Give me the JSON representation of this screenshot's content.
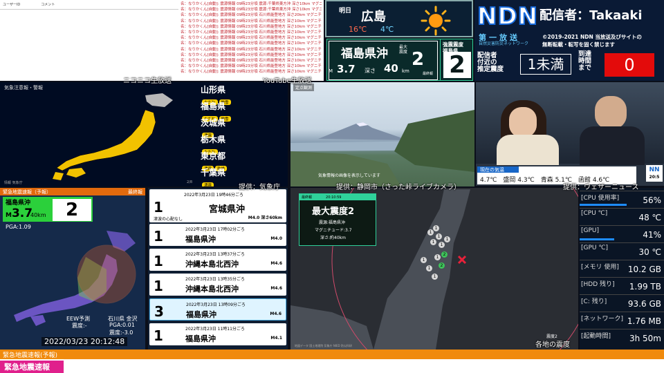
{
  "comments_left": {
    "col1": "ユーザーID",
    "col2": "コメント"
  },
  "comments_right": [
    "名：なりかくん[自動]: 震源情報 09時23分頃 震源:千葉県東方沖 深さ10km マグニチュード4.9 予想最大震度4",
    "名：なりかくん[自動]: 震源情報 09時23分頃 震源:千葉県東方沖 深さ10km マグニチュード4.9 予想最大震度4",
    "名：なりかくん[自動]: 震源情報 09時23分頃 石川県能登地方 深さ20km マグニチュード4.7 予想最大震度4",
    "名：なりかくん[自動]: 震源情報 09時23分頃 石川県能登地方 深さ10km マグニチュード4.7 予想最大震度4",
    "名：なりかくん[自動]: 震源情報 09時23分頃 石川県能登地方 深さ10km マグニチュード4.6 予想最大震度4",
    "名：なりかくん[自動]: 震源情報 09時23分頃 石川県能登地方 深さ10km マグニチュード4.6 予想最大震度4",
    "名：なりかくん[自動]: 震源情報 09時23分頃 石川県能登地方 深さ10km マグニチュード4.6 予想最大震度4",
    "名：なりかくん[自動]: 震源情報 09時23分頃 石川県能登地方 深さ10km マグニチュード4.6 予想最大震度4",
    "名：なりかくん[自動]: 震源情報 09時23分頃 石川県能登地方 深さ10km マグニチュード4.6 予想最大震度4",
    "名：なりかくん[自動]: 震源情報 09時23分頃 石川県能登地方 深さ10km マグニチュード4.6 予想最大震度4",
    "名：なりかくん[自動]: 震源情報 09時23分頃 石川県能登地方 深さ10km マグニチュード4.6 予想最大震度4",
    "名：なりかくん[自動]: 震源情報 09時23分頃 石川県能登地方 深さ10km マグニチュード4.6 予想最大震度4",
    "名：なりかくん[自動]: 震源情報 09時23分頃 石川県能登地方 深さ10km マグニチュード4.6 予想最大震度4"
  ],
  "weather": {
    "label": "明日",
    "city": "広島",
    "high": "16℃",
    "low": "4℃",
    "icon": "sun-icon"
  },
  "ndn": {
    "logo": "NDN",
    "streamer": "配信者：Takaaki",
    "channel": "第一放送",
    "channel_sub": "自然災害防災ネットワーク",
    "copyright_1": "©2019-2021 NDN 当放送及びサイトの",
    "copyright_2": "無断転載・転写を固く禁じます",
    "est_label_1": "配信者",
    "est_label_2": "付近の",
    "est_label_3": "推定震度",
    "est_value": "1未満",
    "arrival_label_1": "到達",
    "arrival_label_2": "時間",
    "arrival_label_3": "まで",
    "arrival_value": "0"
  },
  "eew_summary": {
    "area": "福島県沖",
    "max_label_1": "最大",
    "max_label_2": "震度",
    "magnitude_prefix": "M",
    "magnitude": "3.7",
    "depth_label": "深さ",
    "depth": "40",
    "depth_unit": "km",
    "max_int": "2",
    "final": "最終報",
    "side_title_1": "強震震度",
    "side_title_2": "福島県",
    "side_int": "2"
  },
  "credits": {
    "nico": "ニコニコ生放送",
    "youtube": "YouTube生放送",
    "jma": "提供：気象庁",
    "shizuoka": "提供：静岡市（さった峠ライブカメラ）",
    "weathernews": "提供：ウェザーニュース",
    "each_int": "各地の震度"
  },
  "map1": {
    "title": "気象注意報・警報",
    "footer_left": "情報 気象庁",
    "page": "2/8",
    "prefs": [
      {
        "name": "山形県",
        "tags": [
          "なだれ",
          "融雪"
        ]
      },
      {
        "name": "福島県",
        "tags": [
          "なだれ",
          "融雪"
        ]
      },
      {
        "name": "茨城県",
        "tags": [
          "濃霧"
        ]
      },
      {
        "name": "栃木県",
        "tags": [
          "なだれ"
        ]
      },
      {
        "name": "東京都",
        "tags": [
          "濃霧",
          "乾燥"
        ]
      },
      {
        "name": "千葉県",
        "tags": [
          "濃霧"
        ]
      }
    ]
  },
  "camera": {
    "label": "定点観測",
    "caption": "気象情報の画像を表示しています"
  },
  "studio": {
    "bar_title": "現在の気温",
    "bar_values": "4.7℃　盛岡 4.3℃　青森 5.1℃　函館 4.6℃",
    "logo": "NN",
    "time": "20:5"
  },
  "eew_map": {
    "header": "緊急地震速報（予報）",
    "final": "最終報",
    "area": "福島県沖",
    "mag_prefix": "M",
    "mag": "3.7",
    "depth": "40km",
    "int": "2",
    "pga": "PGA:1.09",
    "forecast_label": "EEW予測",
    "forecast_int": "震度:-",
    "place": "石川県 金沢",
    "pga2": "PGA:0.01",
    "int2": "震度:-3.0",
    "timestamp": "2022/03/23 20:12:48"
  },
  "quake_list": [
    {
      "int": "1",
      "time": "2022年3月23日 19時46分ごろ",
      "area": "宮城県沖",
      "mag": "M4.0 深さ60km",
      "note": "津波の心配なし"
    },
    {
      "int": "1",
      "time": "2022年3月23日 17時02分ごろ",
      "area": "福島県沖",
      "mag": "M4.0"
    },
    {
      "int": "1",
      "time": "2022年3月23日 13時37分ごろ",
      "area": "沖縄本島北西沖",
      "mag": "M4.6"
    },
    {
      "int": "1",
      "time": "2022年3月23日 13時35分ごろ",
      "area": "沖縄本島北西沖",
      "mag": "M4.6"
    },
    {
      "int": "3",
      "time": "2022年3月23日 13時09分ごろ",
      "area": "福島県沖",
      "mag": "M4.6"
    },
    {
      "int": "1",
      "time": "2022年3月23日 11時11分ごろ",
      "area": "福島県沖",
      "mag": "M4.1"
    }
  ],
  "map3": {
    "header": "最終報",
    "time": "20:10:59",
    "title": "最大震度2",
    "epicenter": "震源:福島県沖",
    "magnitude": "マグニチュード:3.7",
    "depth": "深さ:約40km",
    "legend": "震度2",
    "footer": "地図データ 国土地理院 気象庁 NIED 防災科研"
  },
  "sysmon": [
    {
      "label": "[CPU 使用率]",
      "value": "56%",
      "pct": 56
    },
    {
      "label": "[CPU ℃]",
      "value": "48 ℃",
      "pct": 0
    },
    {
      "label": "[GPU]",
      "value": "41%",
      "pct": 41
    },
    {
      "label": "[GPU ℃]",
      "value": "30 ℃",
      "pct": 0
    },
    {
      "label": "[メモリ 使用]",
      "value": "10.2 GB",
      "pct": 0
    },
    {
      "label": "[HDD 残り]",
      "value": "1.99 TB",
      "pct": 0
    },
    {
      "label": "[C: 残り]",
      "value": "93.6 GB",
      "pct": 0
    },
    {
      "label": "[ネットワーク]",
      "value": "1.76 MB",
      "pct": 0
    },
    {
      "label": "[起動時間]",
      "value": "3h 50m",
      "pct": 0
    }
  ],
  "footer": {
    "orange": "緊急地震速報(予報)",
    "pink": "緊急地震速報"
  }
}
